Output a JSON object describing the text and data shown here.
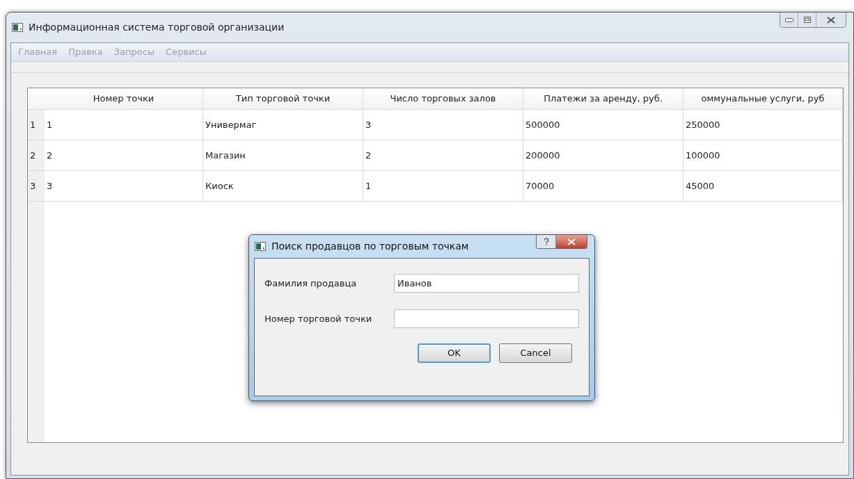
{
  "window": {
    "title": "Информационная система торговой организации"
  },
  "menu": [
    "Главная",
    "Правка",
    "Запросы",
    "Сервисы"
  ],
  "table": {
    "columns": [
      "Номер точки",
      "Тип торговой точки",
      "Число торговых залов",
      "Платежи за аренду, руб.",
      "оммунальные услуги, руб"
    ],
    "rows": [
      {
        "header": "1",
        "cells": [
          "1",
          "Универмаг",
          "3",
          "500000",
          "250000"
        ]
      },
      {
        "header": "2",
        "cells": [
          "2",
          "Магазин",
          "2",
          "200000",
          "100000"
        ]
      },
      {
        "header": "3",
        "cells": [
          "3",
          "Киоск",
          "1",
          "70000",
          "45000"
        ]
      }
    ]
  },
  "dialog": {
    "title": "Поиск продавцов по торговым точкам",
    "fields": [
      {
        "label": "Фамилия продавца",
        "value": "Иванов"
      },
      {
        "label": "Номер торговой точки"
      }
    ],
    "buttons": [
      {
        "label": "OK",
        "default": true
      },
      {
        "label": "Cancel",
        "default": false
      }
    ]
  }
}
